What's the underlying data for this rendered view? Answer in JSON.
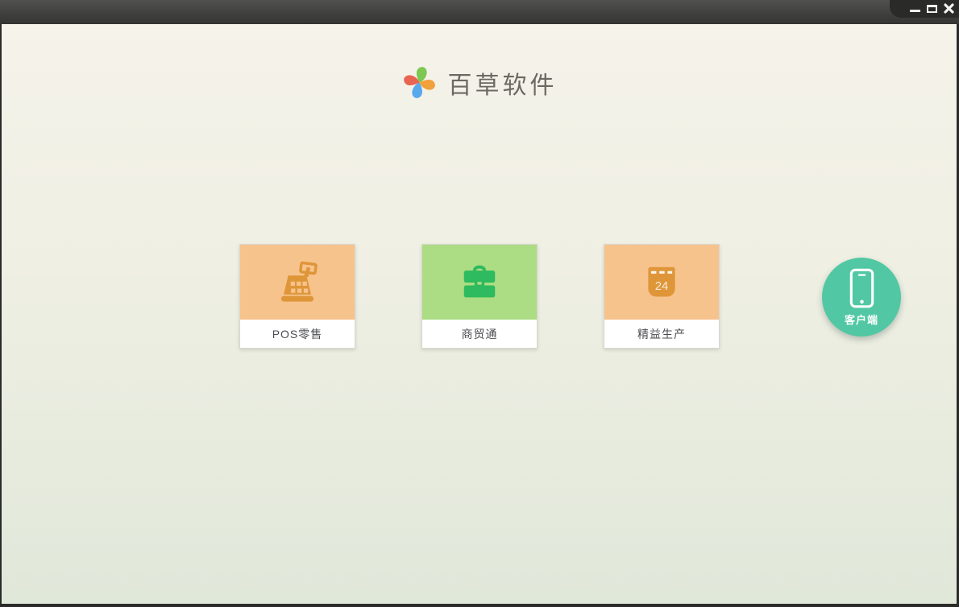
{
  "window": {
    "controls": {
      "minimize_icon": "minimize-icon",
      "maximize_icon": "maximize-icon",
      "close_icon": "close-icon"
    },
    "titlebar_color": "#434342",
    "corner_panel_color": "#2a2a28"
  },
  "header": {
    "app_title": "百草软件",
    "logo_icon": "pinwheel-logo-icon",
    "logo_colors": {
      "top": "#7cc850",
      "right": "#f1a13b",
      "bottom": "#59a8ec",
      "left": "#e96553"
    }
  },
  "products": [
    {
      "label": "POS零售",
      "icon": "cash-register-icon",
      "card_bg": "#f7c38d",
      "icon_color": "#df9639"
    },
    {
      "label": "商贸通",
      "icon": "briefcase-icon",
      "card_bg": "#acdc83",
      "icon_color": "#2eba5e"
    },
    {
      "label": "精益生产",
      "icon": "calendar-icon",
      "card_bg": "#f7c38d",
      "icon_color": "#df9639",
      "calendar_day": "24"
    }
  ],
  "client_button": {
    "label": "客户端",
    "icon": "smartphone-icon",
    "bg": "#51c8a3"
  },
  "colors": {
    "content_bg_top": "#f5f3ea",
    "content_bg_bottom": "#e0e8da",
    "card_label_text": "#4c4d51",
    "title_text": "#6a6a62"
  }
}
